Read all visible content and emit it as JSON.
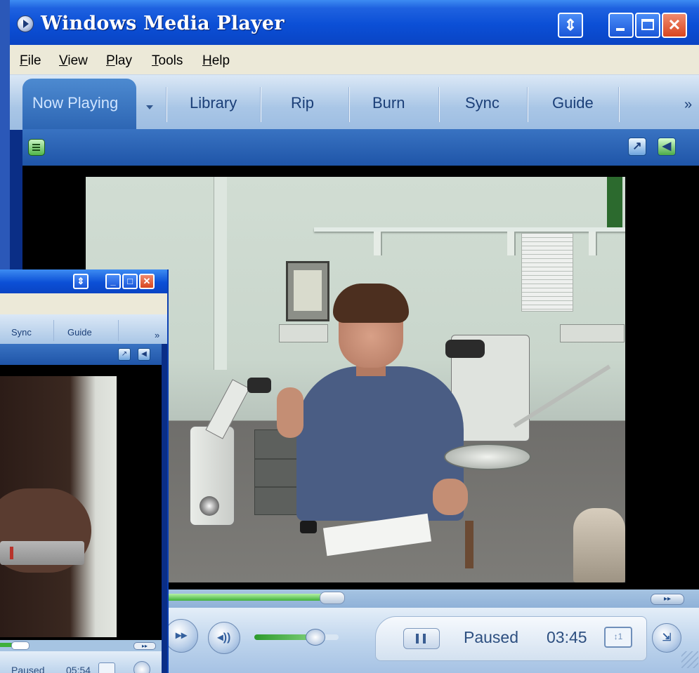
{
  "main_window": {
    "title": "Windows Media Player",
    "menu": [
      "File",
      "View",
      "Play",
      "Tools",
      "Help"
    ],
    "menu_mnemonics": [
      "F",
      "V",
      "P",
      "T",
      "H"
    ],
    "tabs": [
      "Now Playing",
      "Library",
      "Rip",
      "Burn",
      "Sync",
      "Guide"
    ],
    "more_tabs": "»",
    "status": "Paused",
    "time": "03:45",
    "seek_progress_fraction": 0.46,
    "volume_fraction": 0.72
  },
  "secondary_window": {
    "tabs": [
      "Sync",
      "Guide"
    ],
    "more_tabs": "»",
    "status": "Paused",
    "time": "05:54"
  },
  "colors": {
    "titlebar": "#0b4fd6",
    "seek_fill": "#3fb03a",
    "close_button": "#d8461f",
    "menubar": "#ece9d8"
  },
  "icons": [
    "app-icon",
    "switch-mode-icon",
    "minimize-icon",
    "maximize-icon",
    "close-icon",
    "menu-toggle-icon",
    "compact-mode-icon",
    "fullscreen-icon",
    "play-icon",
    "mute-icon",
    "pause-icon",
    "time-display-icon",
    "fast-forward-icon",
    "skip-icon"
  ]
}
